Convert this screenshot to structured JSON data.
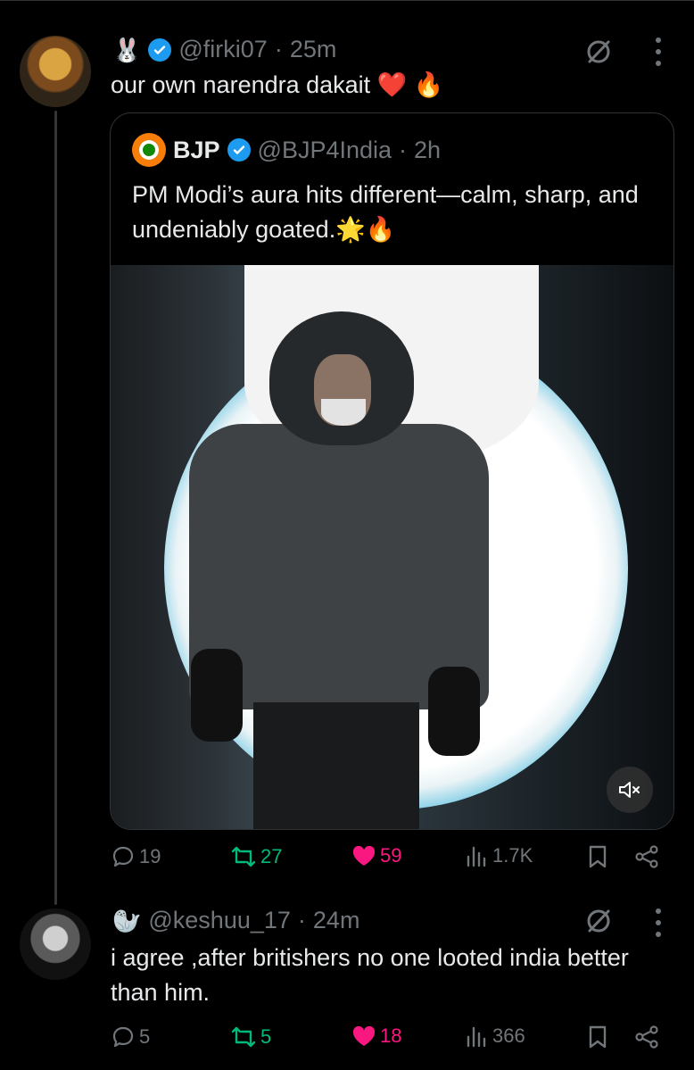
{
  "colors": {
    "background": "#000000",
    "text": "#e7e9ea",
    "muted": "#71767b",
    "verified": "#1d9bf0",
    "retweet": "#00ba7c",
    "like": "#f91880"
  },
  "reply1": {
    "emoji_prefix": "🐰",
    "handle": "@firki07",
    "separator": "·",
    "time": "25m",
    "text": "our own narendra dakait ❤️ 🔥",
    "quote": {
      "name": "BJP",
      "handle": "@BJP4India",
      "separator": "·",
      "time": "2h",
      "text": "PM Modi’s aura hits different—calm, sharp, and undeniably goated.🌟🔥",
      "media": {
        "type": "video",
        "muted": true,
        "mute_icon": "speaker-mute-icon"
      }
    },
    "actions": {
      "replies": "19",
      "reposts": "27",
      "likes": "59",
      "views": "1.7K"
    }
  },
  "reply2": {
    "emoji_prefix": "🦭",
    "handle": "@keshuu_17",
    "separator": "·",
    "time": "24m",
    "text": "i agree ,after britishers no one looted india better than him.",
    "actions": {
      "replies": "5",
      "reposts": "5",
      "likes": "18",
      "views": "366"
    }
  }
}
